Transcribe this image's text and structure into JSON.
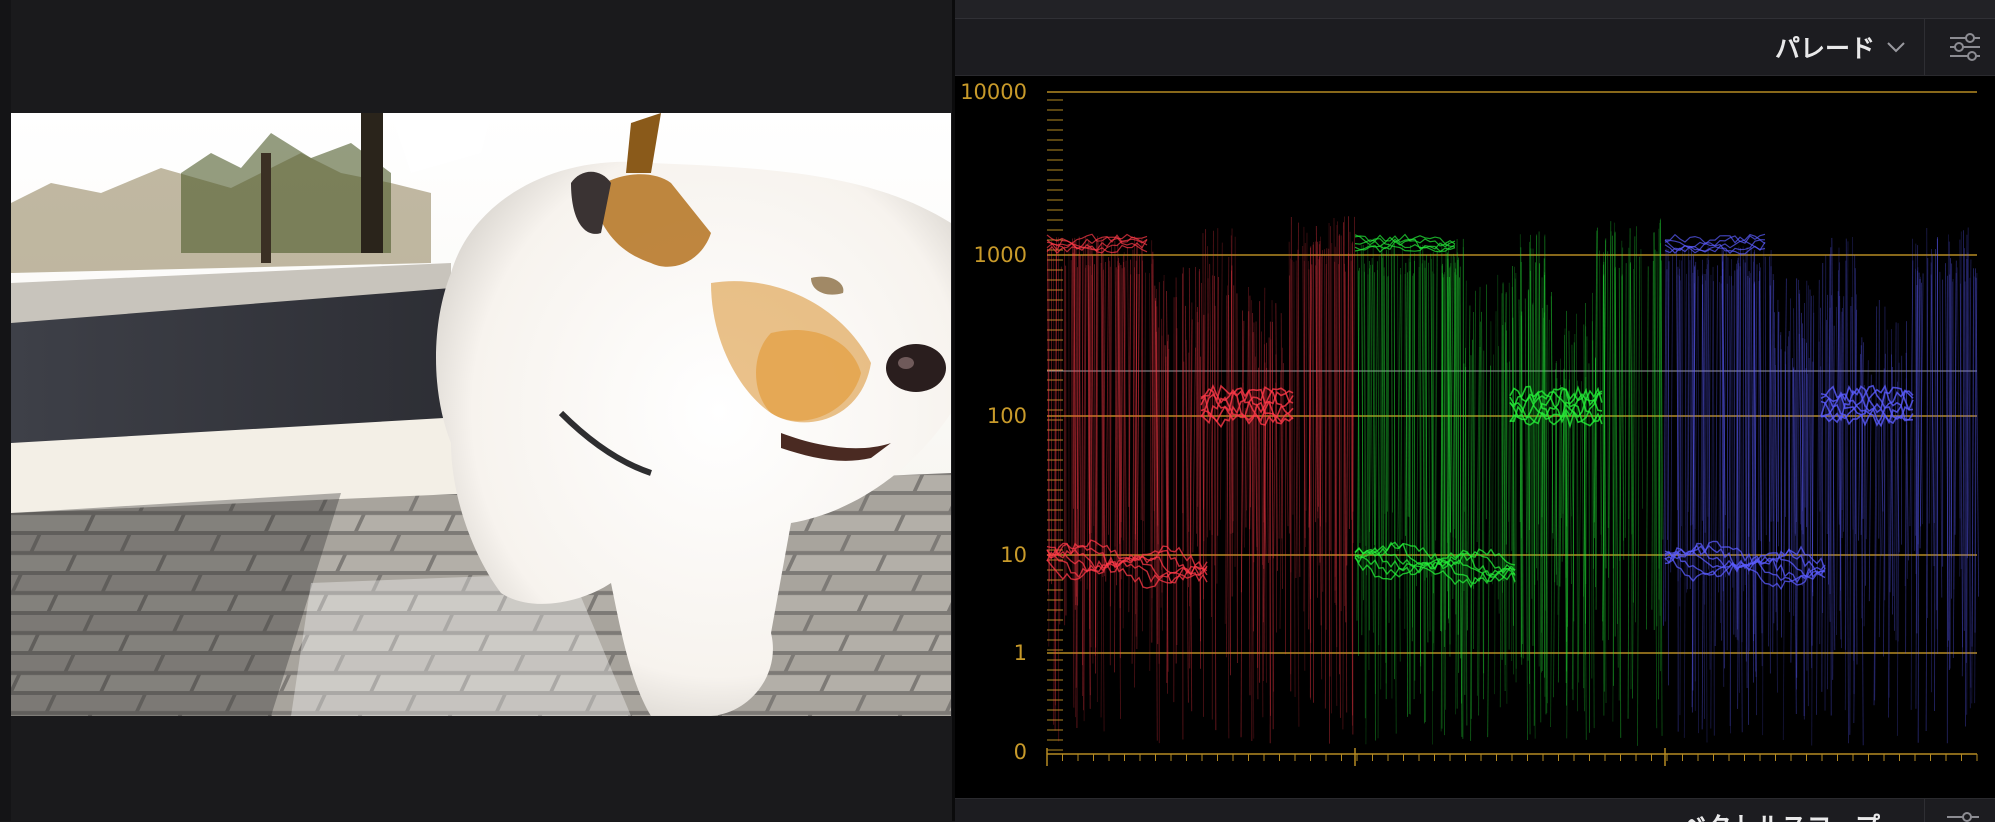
{
  "scope": {
    "mode_label": "パレード",
    "mode_chevron_icon": "chevron-down-icon",
    "settings_icon": "sliders-icon",
    "y_tick_labels": [
      "10000",
      "1000",
      "100",
      "10",
      "1",
      "0"
    ],
    "channels": [
      "red",
      "green",
      "blue"
    ],
    "colors": {
      "grid": "#b58a22",
      "red": "#ff3a48",
      "green": "#25f03a",
      "blue": "#5b5cff"
    }
  },
  "next_panel": {
    "label": "ベクトルスコープ"
  },
  "viewer": {
    "image_description_icon": "video-frame"
  }
}
